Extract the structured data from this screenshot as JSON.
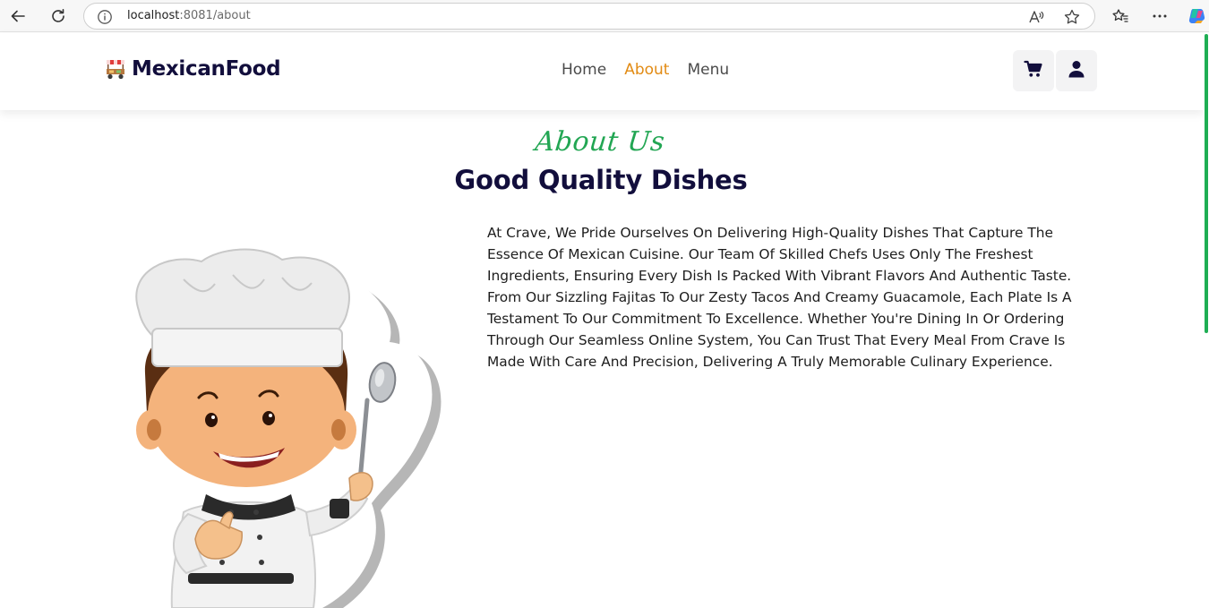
{
  "browser": {
    "url_host": "localhost",
    "url_rest": ":8081/about",
    "icons": [
      "back-arrow-icon",
      "reload-icon",
      "info-icon",
      "read-aloud-icon",
      "star-icon",
      "favorites-icon",
      "more-icon",
      "copilot-icon"
    ]
  },
  "header": {
    "brand": "MexicanFood",
    "nav": [
      "Home",
      "About",
      "Menu"
    ],
    "active_nav": "About",
    "icons": [
      "cart-icon",
      "user-icon"
    ]
  },
  "about": {
    "eyebrow": "About Us",
    "heading": "Good Quality Dishes",
    "body": "At Crave, We Pride Ourselves On Delivering High-Quality Dishes That Capture The Essence Of Mexican Cuisine. Our Team Of Skilled Chefs Uses Only The Freshest Ingredients, Ensuring Every Dish Is Packed With Vibrant Flavors And Authentic Taste. From Our Sizzling Fajitas To Our Zesty Tacos And Creamy Guacamole, Each Plate Is A Testament To Our Commitment To Excellence. Whether You're Dining In Or Ordering Through Our Seamless Online System, You Can Trust That Every Meal From Crave Is Made With Care And Precision, Delivering A Truly Memorable Culinary Experience."
  },
  "colors": {
    "brand_navy": "#120e3c",
    "accent_orange": "#e28b14",
    "accent_green": "#22a653"
  }
}
